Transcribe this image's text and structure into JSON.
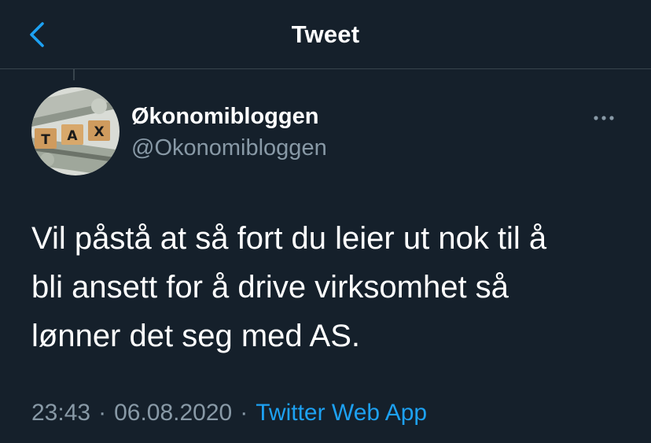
{
  "header": {
    "back_icon": "chevron-left-icon",
    "title": "Tweet"
  },
  "tweet": {
    "author": {
      "display_name": "Økonomibloggen",
      "handle": "@Okonomibloggen",
      "avatar_tiles": [
        "T",
        "A",
        "X"
      ]
    },
    "more_icon": "more-horizontal-icon",
    "text": "Vil påstå at så fort du leier ut nok til å\nbli ansett for å drive virksomhet så\nlønner det seg med AS.",
    "time": "23:43",
    "date": "06.08.2020",
    "separator": "·",
    "source": "Twitter Web App"
  },
  "colors": {
    "background": "#15202b",
    "text_primary": "#ffffff",
    "text_secondary": "#8899a6",
    "accent": "#1da1f2",
    "divider": "#38444d"
  }
}
